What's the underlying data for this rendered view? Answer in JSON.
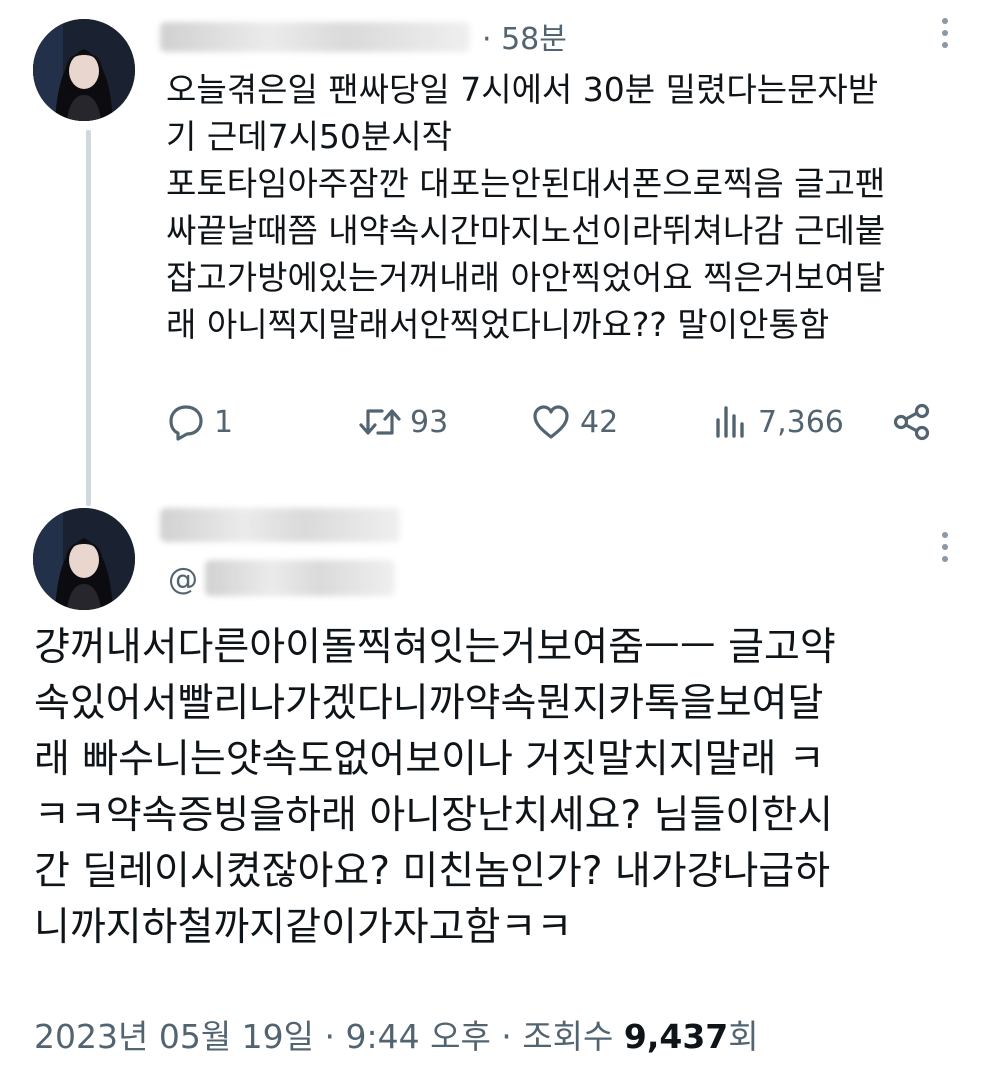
{
  "tweet1": {
    "time": "· 58분",
    "lines": [
      "오늘겪은일 팬싸당일 7시에서 30분 밀렸다는문자받",
      "기 근데7시50분시작",
      "포토타임아주잠깐 대포는안된대서폰으로찍음 글고팬",
      "싸끝날때쯤 내약속시간마지노선이라뛰쳐나감 근데붙",
      "잡고가방에있는거꺼내래 아안찍었어요 찍은거보여달",
      "래 아니찍지말래서안찍었다니까요?? 말이안통함"
    ],
    "actions": {
      "reply_count": "1",
      "retweet_count": "93",
      "like_count": "42",
      "view_count": "7,366"
    },
    "icons": [
      "reply-icon",
      "retweet-icon",
      "like-icon",
      "views-icon",
      "share-icon"
    ]
  },
  "tweet2": {
    "handle": "@",
    "lines": [
      "걍꺼내서다른아이돌찍혀잇는거보여줌ㅡㅡ 글고약",
      "속있어서빨리나가겠다니까약속뭔지카톡을보여달",
      "래  빠수니는얏속도없어보이나 거짓말치지말래 ㅋ",
      "ㅋㅋ약속증빙을하래 아니장난치세요? 님들이한시",
      "간 딜레이시켰잖아요? 미친놈인가? 내가걍나급하",
      "니까지하철까지같이가자고함ㅋㅋ"
    ],
    "meta": {
      "date_time": "2023년 05월 19일 · 9:44 오후 · 조회수 ",
      "views": "9,437",
      "views_suffix": "회"
    }
  },
  "colors": {
    "secondary_text": "#536471",
    "primary_text": "#0f1419",
    "thread_line": "#cfd9de"
  }
}
